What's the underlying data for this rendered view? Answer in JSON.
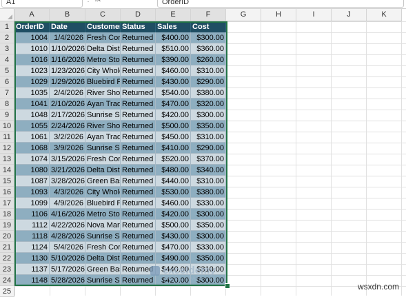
{
  "formula_bar": {
    "name_box": "A1",
    "fx": "fx",
    "content": "OrderID"
  },
  "columns": [
    "A",
    "B",
    "C",
    "D",
    "E",
    "F",
    "G",
    "H",
    "I",
    "J",
    "K"
  ],
  "rows": [
    "1",
    "2",
    "3",
    "4",
    "5",
    "6",
    "7",
    "8",
    "9",
    "10",
    "11",
    "12",
    "13",
    "14",
    "15",
    "16",
    "17",
    "18",
    "19",
    "20",
    "21",
    "22",
    "23",
    "24",
    "25"
  ],
  "table": {
    "headers": [
      "OrderID",
      "Date",
      "Customer",
      "Status",
      "Sales",
      "Cost"
    ],
    "rows": [
      [
        "1004",
        "1/4/2026",
        "Fresh Corner",
        "Returned",
        "$400.00",
        "$300.00"
      ],
      [
        "1010",
        "1/10/2026",
        "Delta Distributors",
        "Returned",
        "$510.00",
        "$360.00"
      ],
      [
        "1016",
        "1/16/2026",
        "Metro Store",
        "Returned",
        "$390.00",
        "$260.00"
      ],
      [
        "1023",
        "1/23/2026",
        "City Wholesale",
        "Returned",
        "$460.00",
        "$310.00"
      ],
      [
        "1029",
        "1/29/2026",
        "Bluebird Foods",
        "Returned",
        "$430.00",
        "$290.00"
      ],
      [
        "1035",
        "2/4/2026",
        "River Shop",
        "Returned",
        "$540.00",
        "$380.00"
      ],
      [
        "1041",
        "2/10/2026",
        "Ayan Traders",
        "Returned",
        "$470.00",
        "$320.00"
      ],
      [
        "1048",
        "2/17/2026",
        "Sunrise Supply",
        "Returned",
        "$420.00",
        "$300.00"
      ],
      [
        "1055",
        "2/24/2026",
        "River Shop",
        "Returned",
        "$500.00",
        "$350.00"
      ],
      [
        "1061",
        "3/2/2026",
        "Ayan Traders",
        "Returned",
        "$450.00",
        "$310.00"
      ],
      [
        "1068",
        "3/9/2026",
        "Sunrise Supply",
        "Returned",
        "$410.00",
        "$290.00"
      ],
      [
        "1074",
        "3/15/2026",
        "Fresh Corner",
        "Returned",
        "$520.00",
        "$370.00"
      ],
      [
        "1080",
        "3/21/2026",
        "Delta Distributors",
        "Returned",
        "$480.00",
        "$340.00"
      ],
      [
        "1087",
        "3/28/2026",
        "Green Basket",
        "Returned",
        "$440.00",
        "$310.00"
      ],
      [
        "1093",
        "4/3/2026",
        "City Wholesale",
        "Returned",
        "$530.00",
        "$380.00"
      ],
      [
        "1099",
        "4/9/2026",
        "Bluebird Foods",
        "Returned",
        "$460.00",
        "$330.00"
      ],
      [
        "1106",
        "4/16/2026",
        "Metro Store",
        "Returned",
        "$420.00",
        "$300.00"
      ],
      [
        "1112",
        "4/22/2026",
        "Nova Mart",
        "Returned",
        "$500.00",
        "$350.00"
      ],
      [
        "1118",
        "4/28/2026",
        "Sunrise Supply",
        "Returned",
        "$430.00",
        "$300.00"
      ],
      [
        "1124",
        "5/4/2026",
        "Fresh Corner",
        "Returned",
        "$470.00",
        "$330.00"
      ],
      [
        "1130",
        "5/10/2026",
        "Delta Distributors",
        "Returned",
        "$490.00",
        "$350.00"
      ],
      [
        "1137",
        "5/17/2026",
        "Green Basket",
        "Returned",
        "$440.00",
        "$310.00"
      ],
      [
        "1148",
        "5/28/2026",
        "Sunrise Supply",
        "Returned",
        "$420.00",
        "$300.00"
      ]
    ]
  },
  "watermark": {
    "name": "exceldemy",
    "sub": "EXCEL · DATA · BI"
  },
  "site_mark": "wsxdn.com",
  "colors": {
    "header_bg": "#1f4e63",
    "band_dark": "#8eaec0",
    "band_light": "#cdd9e0",
    "selection": "#217346"
  }
}
